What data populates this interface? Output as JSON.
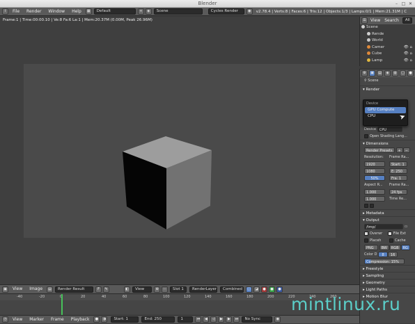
{
  "window": {
    "title": "Blender"
  },
  "menubar": {
    "menus": [
      "File",
      "Render",
      "Window",
      "Help"
    ],
    "layout": "Default",
    "scene": "Scene",
    "engine": "Cycles Render",
    "stats": "v2.78.4 | Verts:8 | Faces:6 | Tris:12 | Objects:1/3 | Lamps:0/1 | Mem:21.31M | Cube"
  },
  "viewport": {
    "info": "Frame:1 | Time:00:00.10 | Ve:8 Fa:6 La:1 | Mem:20.37M (0.00M, Peak 26.96M)"
  },
  "image_header": {
    "menus": [
      "View",
      "Image"
    ],
    "image_name": "Render Result",
    "view": "View",
    "slot": "Slot 1",
    "layer": "RenderLayer",
    "pass": "Combined"
  },
  "timeline": {
    "ticks": [
      "-40",
      "-20",
      "0",
      "20",
      "40",
      "60",
      "80",
      "100",
      "120",
      "140",
      "160",
      "180",
      "200",
      "220",
      "240",
      "260"
    ],
    "menus": [
      "View",
      "Marker",
      "Frame",
      "Playback"
    ],
    "start_label": "Start:",
    "start_value": "1",
    "end_label": "End:",
    "end_value": "250",
    "current": "1",
    "sync": "No Sync"
  },
  "outliner": {
    "tabs": [
      "View",
      "Search",
      "All"
    ],
    "items": [
      {
        "label": "Scene",
        "color": "#d0d0d0"
      },
      {
        "label": "Rende",
        "color": "#d0d0d0"
      },
      {
        "label": "World",
        "color": "#c9c9c9"
      },
      {
        "label": "Camer",
        "color": "#e08a3a"
      },
      {
        "label": "Cube",
        "color": "#e08a3a"
      },
      {
        "label": "Lamp",
        "color": "#e0b840"
      }
    ]
  },
  "properties": {
    "scene_label": "Scene",
    "render_section": "Render",
    "device_label": "Device",
    "device_value": "CPU",
    "open_shading": "Open Shading Lang...",
    "dimensions_section": "Dimensions",
    "render_presets": "Render Presets",
    "resolution_label": "Resolution:",
    "frame_range_label": "Frame Ra...",
    "res_x": "1920",
    "res_y": "1080",
    "res_pct": "50%",
    "start_frame": "Start: 1",
    "end_frame": "E: 250",
    "frame_step": "Fra: 1",
    "aspect_label": "Aspect R...",
    "frame_rate_label": "Frame Ra...",
    "aspect_x": "1.000",
    "aspect_y": "1.000",
    "fps": "24 fps",
    "time_label": "Time Re...",
    "metadata_section": "Metadata",
    "output_section": "Output",
    "output_path": "/tmp/",
    "overwrite": "Overwr",
    "file_ext": "File Ext",
    "placeholders": "Placeh",
    "cache_result": "Cache",
    "format": "PNG",
    "color_bw": "BW",
    "color_rgb": "RGB",
    "color_rgba": "RG",
    "color_depth_label": "Color D",
    "depth_8": "8",
    "depth_16": "16",
    "compression": "Compression: 15%",
    "freestyle_section": "Freestyle",
    "sampling_section": "Sampling",
    "geometry_section": "Geometry",
    "light_paths_section": "Light Paths",
    "motion_blur_section": "Motion Blur"
  },
  "dropdown": {
    "title": "Device",
    "options": [
      "GPU Compute",
      "CPU"
    ],
    "selected_index": 0
  },
  "watermark": "mintlinux.ru",
  "colors": {
    "accent": "#5680c2",
    "playhead": "#47c25a",
    "watermark": "#5dd6d0"
  }
}
